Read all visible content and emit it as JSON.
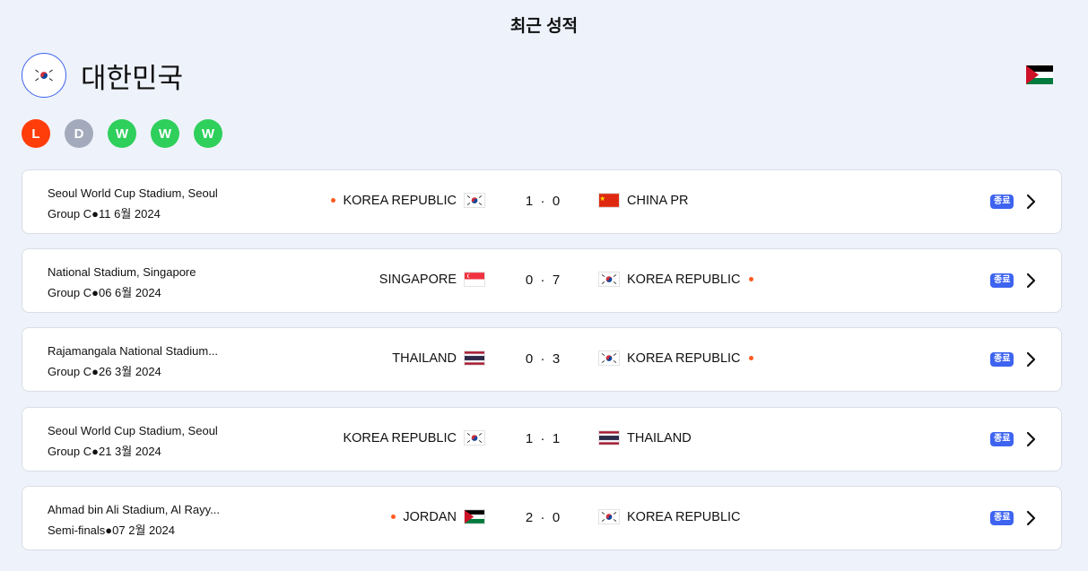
{
  "header": {
    "title": "최근 성적"
  },
  "team": {
    "name": "대한민국",
    "logo_icon": "korea-flag-icon",
    "opponent_flag_icon": "jordan-flag-icon"
  },
  "form": [
    {
      "result": "L",
      "color": "#ff3d0a"
    },
    {
      "result": "D",
      "color": "#a3aabb"
    },
    {
      "result": "W",
      "color": "#2fcf5c"
    },
    {
      "result": "W",
      "color": "#2fcf5c"
    },
    {
      "result": "W",
      "color": "#2fcf5c"
    }
  ],
  "matches": [
    {
      "venue": "Seoul World Cup Stadium, Seoul",
      "meta": "Group C●11 6월 2024",
      "home": "KOREA REPUBLIC",
      "home_flag": "korea",
      "home_winner": true,
      "score": "1  ·  0",
      "away": "CHINA PR",
      "away_flag": "china",
      "away_winner": false,
      "status": "종료"
    },
    {
      "venue": "National Stadium, Singapore",
      "meta": "Group C●06 6월 2024",
      "home": "SINGAPORE",
      "home_flag": "singapore",
      "home_winner": false,
      "score": "0  ·  7",
      "away": "KOREA REPUBLIC",
      "away_flag": "korea",
      "away_winner": true,
      "status": "종료"
    },
    {
      "venue": "Rajamangala National Stadium...",
      "meta": "Group C●26 3월 2024",
      "home": "THAILAND",
      "home_flag": "thailand",
      "home_winner": false,
      "score": "0  ·  3",
      "away": "KOREA REPUBLIC",
      "away_flag": "korea",
      "away_winner": true,
      "status": "종료"
    },
    {
      "venue": "Seoul World Cup Stadium, Seoul",
      "meta": "Group C●21 3월 2024",
      "home": "KOREA REPUBLIC",
      "home_flag": "korea",
      "home_winner": false,
      "score": "1  ·  1",
      "away": "THAILAND",
      "away_flag": "thailand",
      "away_winner": false,
      "status": "종료"
    },
    {
      "venue": "Ahmad bin Ali Stadium, Al Rayy...",
      "meta": "Semi-finals●07 2월 2024",
      "home": "JORDAN",
      "home_flag": "jordan",
      "home_winner": true,
      "score": "2  ·  0",
      "away": "KOREA REPUBLIC",
      "away_flag": "korea",
      "away_winner": false,
      "status": "종료"
    }
  ]
}
